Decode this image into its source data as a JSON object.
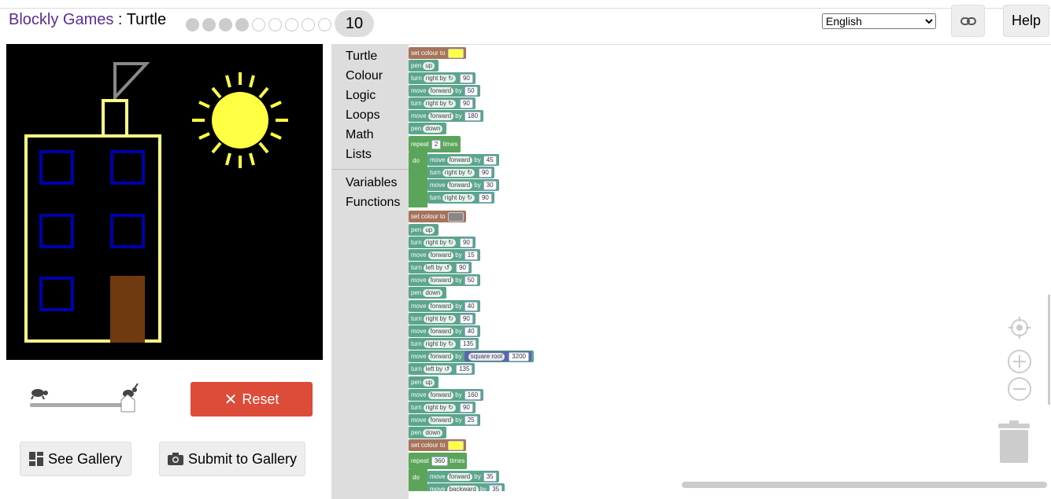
{
  "header": {
    "app_name": "Blockly Games",
    "separator": " : ",
    "game_name": "Turtle",
    "levels_completed": 4,
    "levels_total": 10,
    "current_level": "10",
    "language": "English",
    "link_icon": "link-icon",
    "help_label": "Help"
  },
  "controls": {
    "reset_label": "Reset",
    "see_gallery_label": "See Gallery",
    "submit_gallery_label": "Submit to Gallery",
    "speed_slow_icon": "turtle-icon",
    "speed_fast_icon": "rabbit-icon"
  },
  "toolbox": {
    "categories": [
      "Turtle",
      "Colour",
      "Logic",
      "Loops",
      "Math",
      "Lists"
    ],
    "extra_categories": [
      "Variables",
      "Functions"
    ]
  },
  "blocks": {
    "set_colour": "set colour to",
    "pen": "pen",
    "up": "up",
    "down": "down",
    "turn": "turn",
    "move": "move",
    "right_by": "right by ↻",
    "left_by": "left by ↺",
    "forward": "forward",
    "backward": "backward",
    "by": "by",
    "repeat": "repeat",
    "times": "times",
    "do": "do",
    "square_root": "square root",
    "values": [
      "90",
      "50",
      "90",
      "180",
      "2",
      "45",
      "90",
      "30",
      "90",
      "90",
      "15",
      "90",
      "50",
      "40",
      "90",
      "40",
      "135",
      "3200",
      "135",
      "160",
      "90",
      "25",
      "360",
      "35",
      "35"
    ]
  },
  "colors": {
    "brand": "#5c2d91",
    "reset": "#dd4b39",
    "motion_block": "#5ba58c",
    "colour_block": "#a5745b",
    "loop_block": "#5ba55b",
    "math_block": "#5b67a5",
    "swatch_yellow": "#ffff44",
    "swatch_grey": "#888888"
  }
}
